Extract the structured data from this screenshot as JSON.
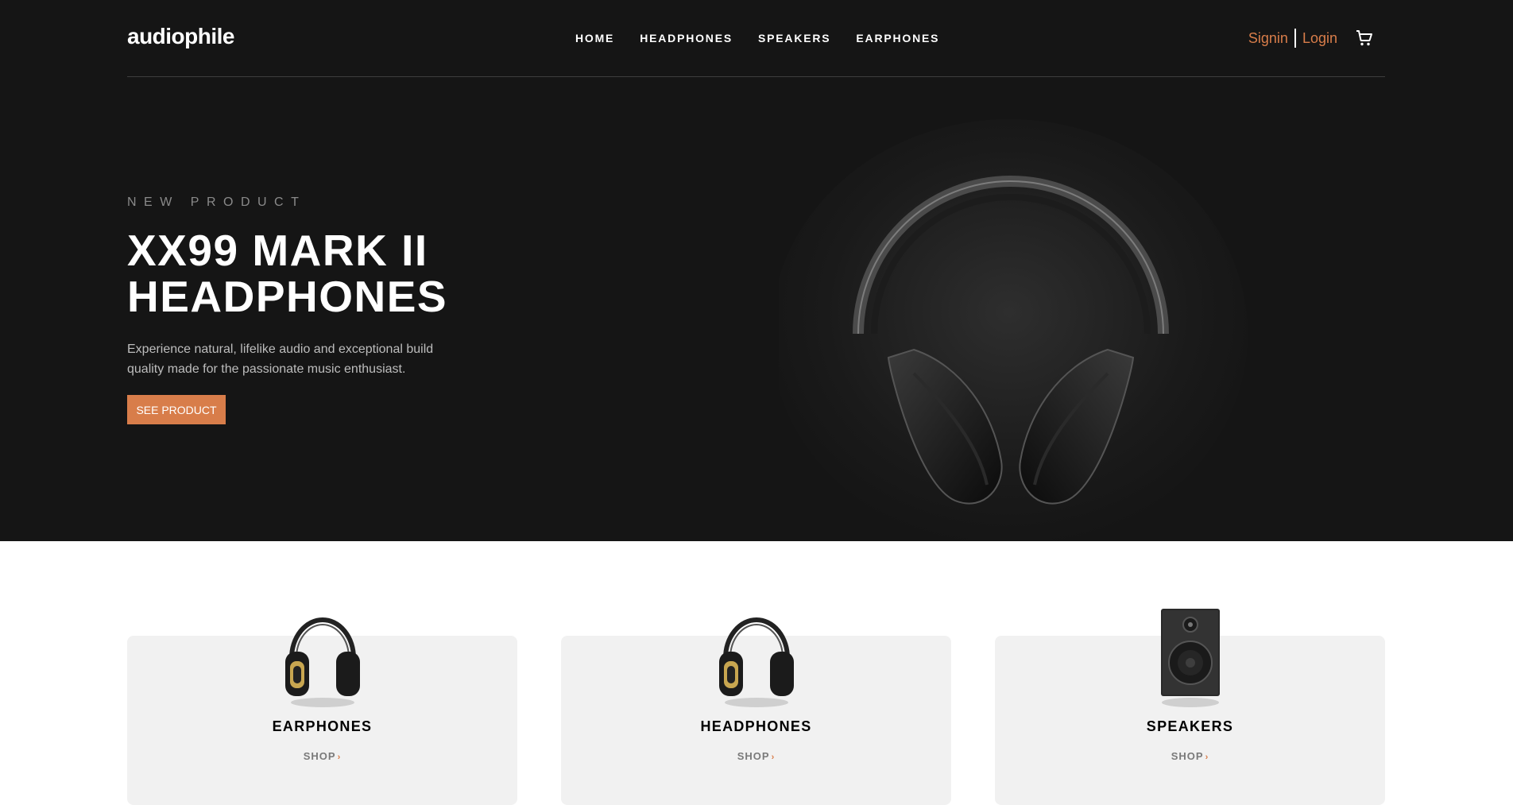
{
  "header": {
    "logo": "audiophile",
    "nav": [
      "HOME",
      "HEADPHONES",
      "SPEAKERS",
      "EARPHONES"
    ],
    "signin": "Signin",
    "login": "Login",
    "cart_icon": "cart-icon"
  },
  "hero": {
    "eyebrow": "NEW PRODUCT",
    "title": "XX99 MARK II HEADPHONES",
    "description": "Experience natural, lifelike audio and exceptional build quality made for the passionate music enthusiast.",
    "cta": "SEE PRODUCT"
  },
  "categories": [
    {
      "title": "EARPHONES",
      "shop": "SHOP"
    },
    {
      "title": "HEADPHONES",
      "shop": "SHOP"
    },
    {
      "title": "SPEAKERS",
      "shop": "SHOP"
    }
  ],
  "colors": {
    "accent": "#d87d4a",
    "hero_bg": "#151515",
    "card_bg": "#f1f1f1"
  }
}
